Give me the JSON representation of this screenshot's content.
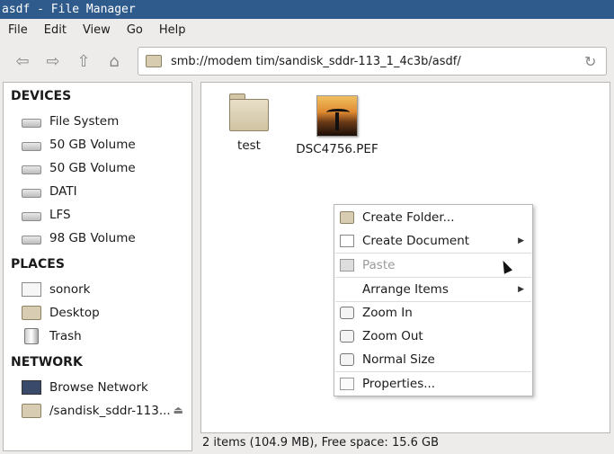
{
  "window": {
    "title": "asdf - File Manager"
  },
  "menubar": [
    "File",
    "Edit",
    "View",
    "Go",
    "Help"
  ],
  "toolbar": {
    "icons": [
      "back-icon",
      "forward-icon",
      "up-icon",
      "home-icon",
      "reload-icon"
    ],
    "address": "smb://modem tim/sandisk_sddr-113_1_4c3b/asdf/"
  },
  "sidebar": {
    "devices_title": "DEVICES",
    "devices": [
      "File System",
      "50 GB Volume",
      "50 GB Volume",
      "DATI",
      "LFS",
      "98 GB Volume"
    ],
    "places_title": "PLACES",
    "places": [
      "sonork",
      "Desktop",
      "Trash"
    ],
    "network_title": "NETWORK",
    "network": [
      "Browse Network",
      "/sandisk_sddr-113..."
    ]
  },
  "files": [
    {
      "name": "test",
      "icon": "folder-icon"
    },
    {
      "name": "DSC4756.PEF",
      "icon": "image-thumbnail"
    }
  ],
  "status": "2 items (104.9 MB), Free space: 15.6 GB",
  "context_menu": {
    "create_folder": "Create Folder...",
    "create_document": "Create Document",
    "paste": "Paste",
    "arrange_items": "Arrange Items",
    "zoom_in": "Zoom In",
    "zoom_out": "Zoom Out",
    "normal_size": "Normal Size",
    "properties": "Properties..."
  },
  "colors": {
    "titlebar": "#2f5a8c",
    "window_bg": "#edeceb"
  }
}
